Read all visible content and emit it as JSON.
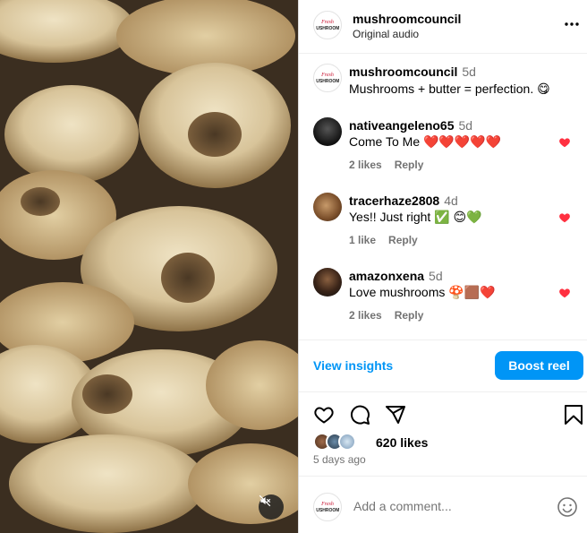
{
  "post": {
    "author": "mushroomcouncil",
    "audio": "Original audio",
    "brand_logo_text": "Fresh MUSHROOMS"
  },
  "caption": {
    "author": "mushroomcouncil",
    "time": "5d",
    "text": "Mushrooms + butter = perfection. 😋"
  },
  "comments": [
    {
      "author": "nativeangeleno65",
      "time": "5d",
      "text": "Come To Me ❤️❤️❤️❤️❤️",
      "likes": "2 likes",
      "reply": "Reply"
    },
    {
      "author": "tracerhaze2808",
      "time": "4d",
      "text": "Yes!! Just right ✅ 😊💚",
      "likes": "1 like",
      "reply": "Reply"
    },
    {
      "author": "amazonxena",
      "time": "5d",
      "text": "Love mushrooms 🍄🟫❤️",
      "likes": "2 likes",
      "reply": "Reply"
    }
  ],
  "actions": {
    "view_insights": "View insights",
    "boost": "Boost reel"
  },
  "likes": {
    "count_text": "620 likes",
    "date": "5 days ago"
  },
  "comment_box": {
    "placeholder": "Add a comment..."
  },
  "colors": {
    "accent": "#0095f6",
    "heart": "#ff3040"
  },
  "icons": [
    "more-icon",
    "heart-icon",
    "comment-icon",
    "share-icon",
    "bookmark-icon",
    "emoji-icon",
    "mute-icon"
  ]
}
